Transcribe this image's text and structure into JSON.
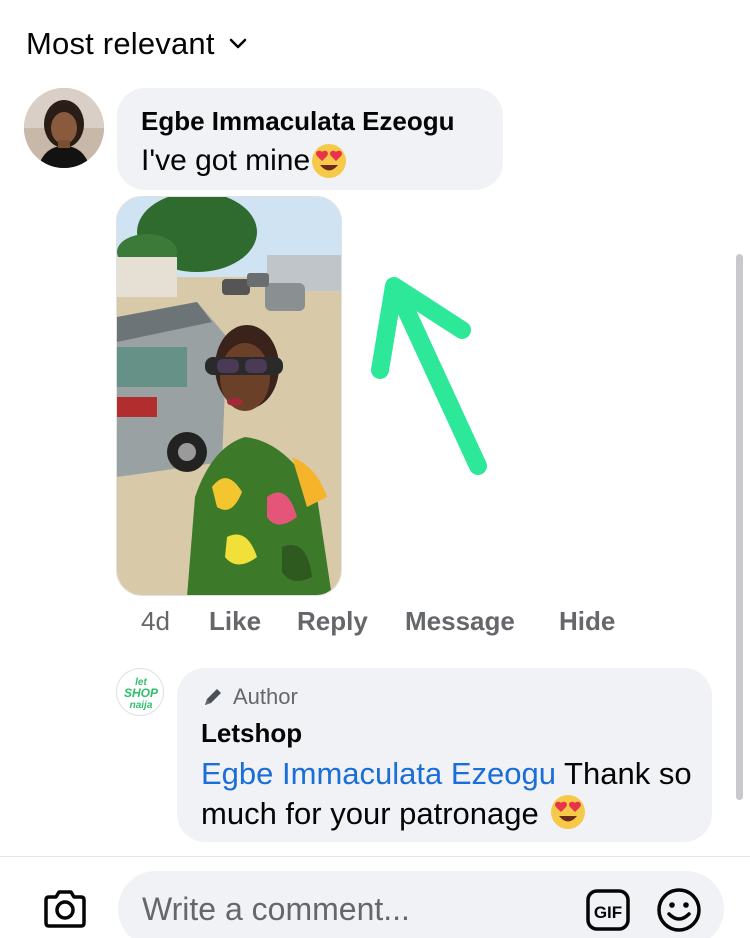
{
  "sort": {
    "label": "Most relevant",
    "icon": "chevron-down-icon"
  },
  "comment": {
    "author": "Egbe Immaculata Ezeogu",
    "text": "I've got mine",
    "emoji": "heart-eyes-emoji",
    "time": "4d",
    "actions": {
      "like": "Like",
      "reply": "Reply",
      "message": "Message",
      "hide": "Hide"
    }
  },
  "annotation": {
    "arrow_color": "#2ee89a"
  },
  "reply": {
    "avatar_text": [
      "let",
      "SHOP",
      "naija"
    ],
    "badge": "Author",
    "author": "Letshop",
    "mention": "Egbe Immaculata Ezeogu",
    "text": " Thank so much for your patronage "
  },
  "composer": {
    "placeholder": "Write a comment...",
    "gif_label": "GIF"
  },
  "colors": {
    "bubble": "#f0f2f5",
    "meta": "#65676b",
    "mention": "#1a6ed8",
    "text": "#050505"
  }
}
